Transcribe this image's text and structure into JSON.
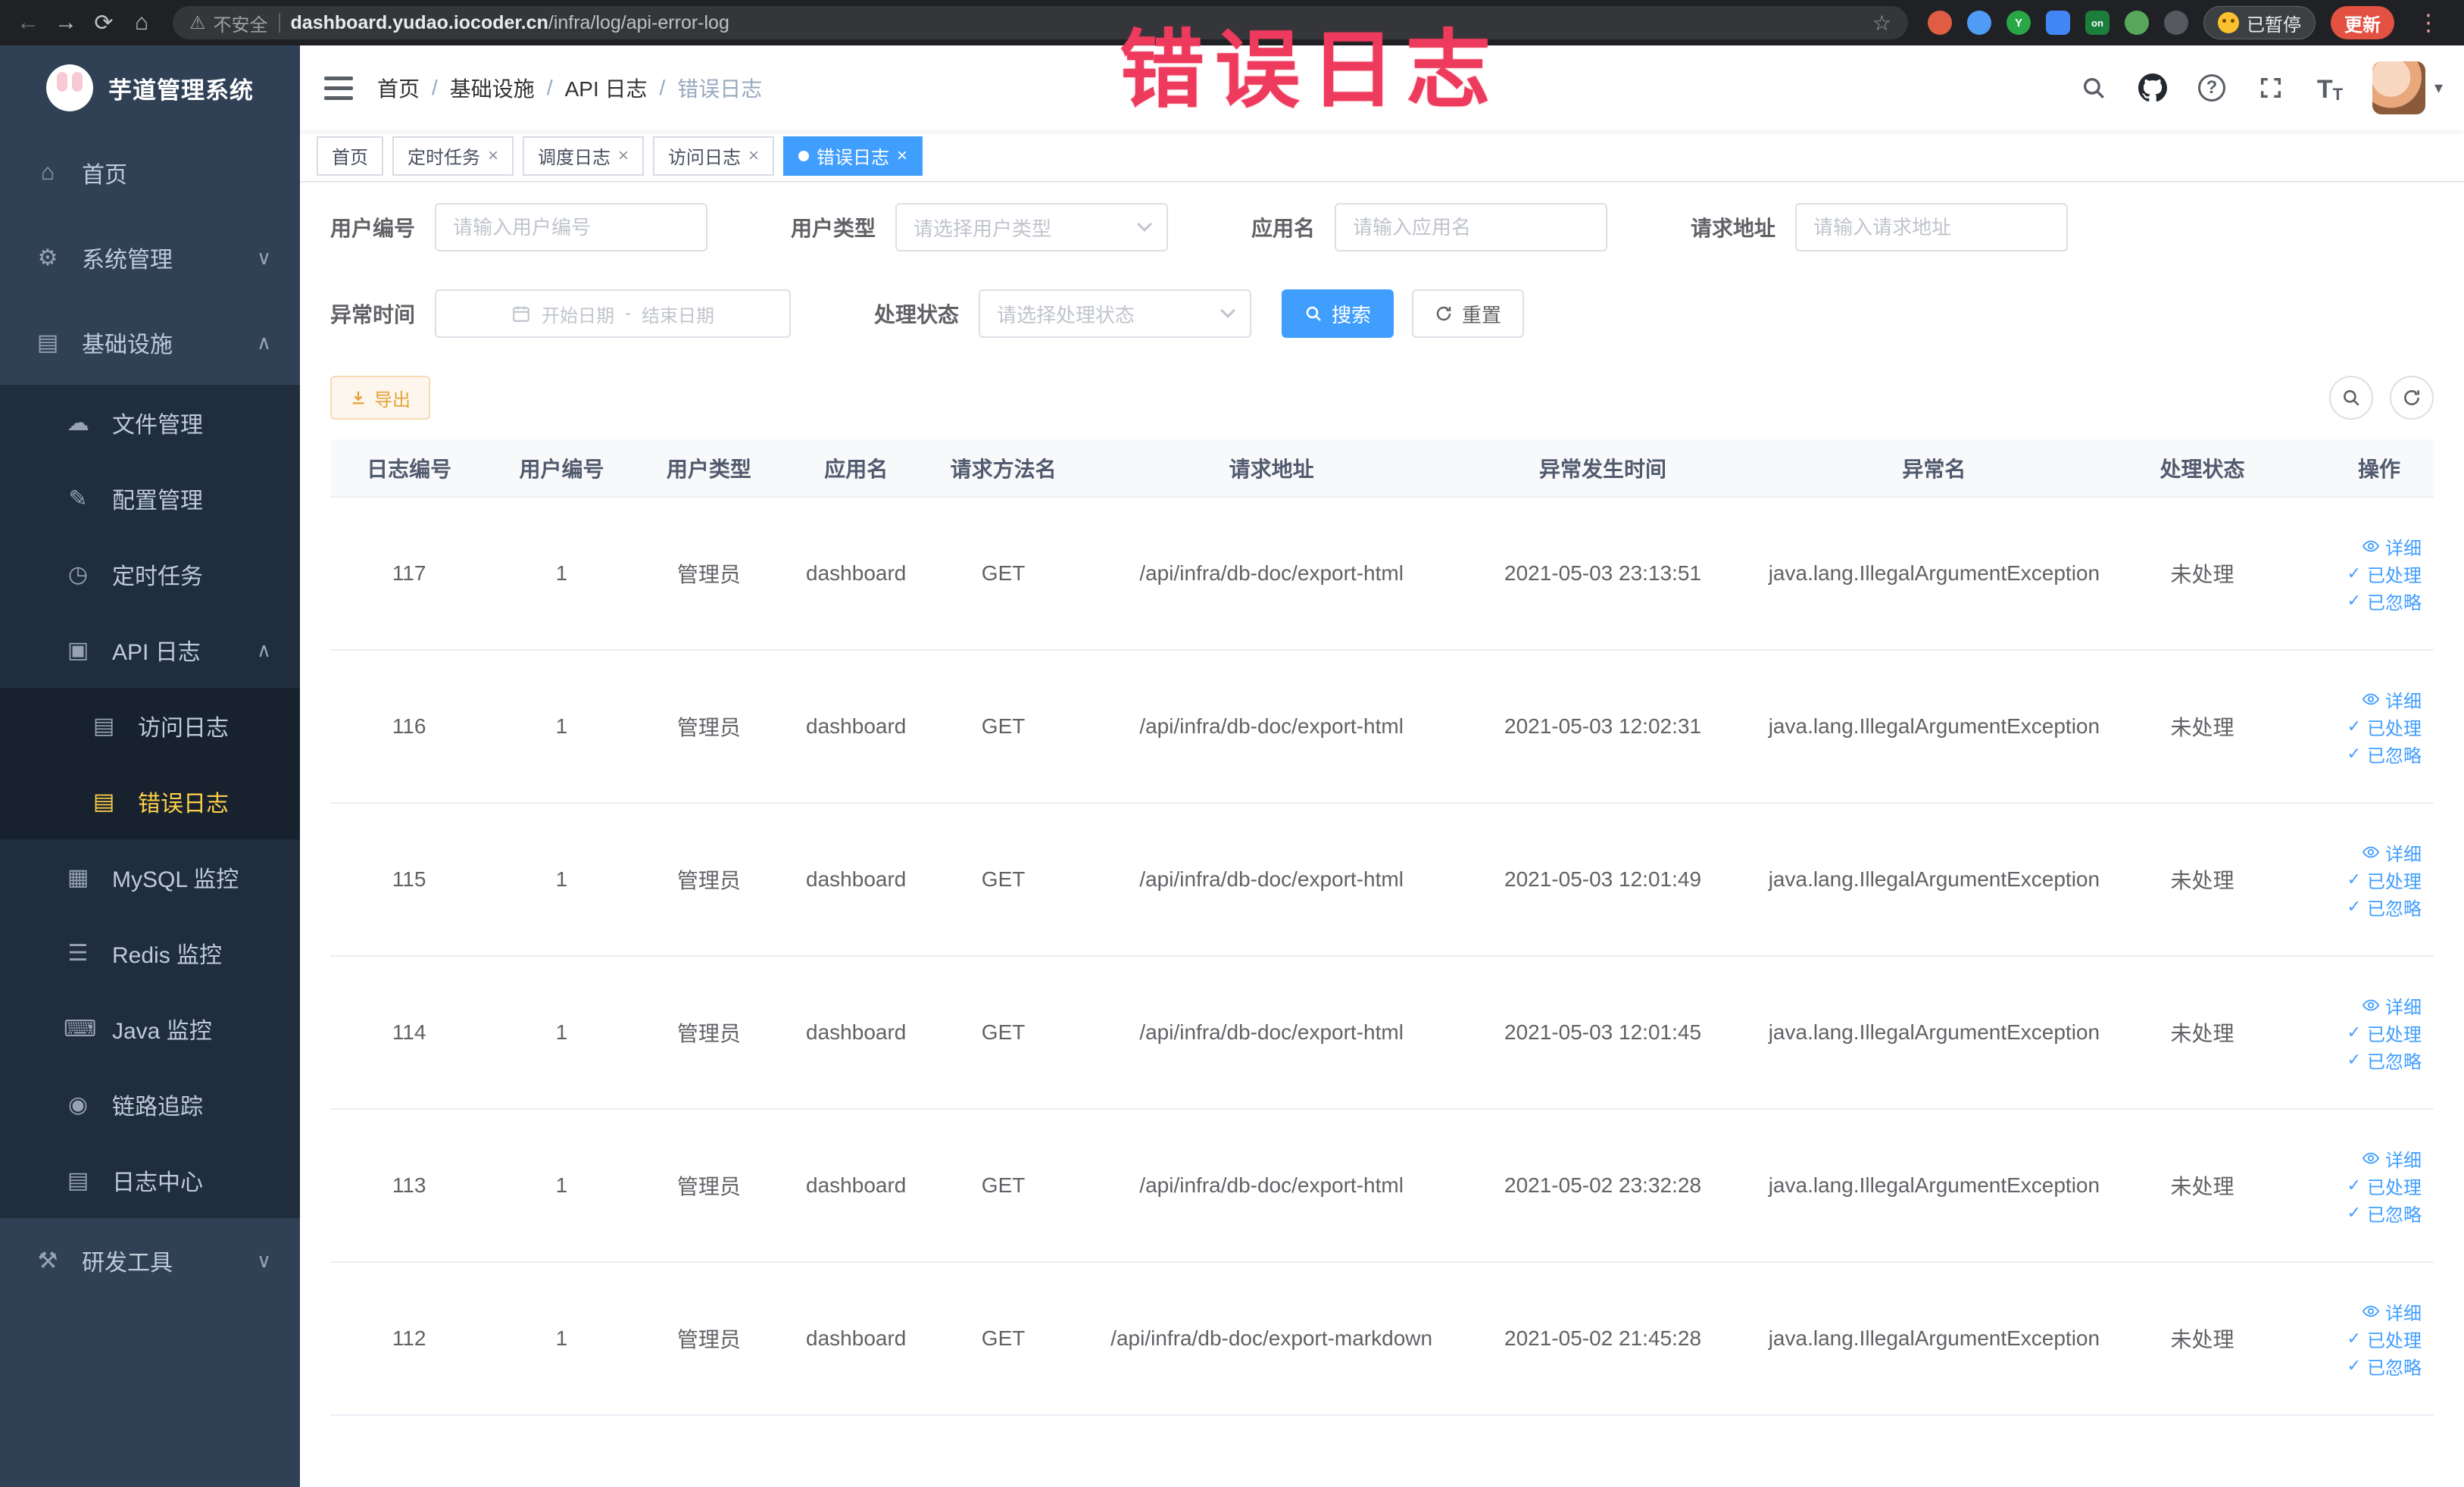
{
  "colors": {
    "primary": "#409eff",
    "warning": "#e6a23c",
    "sidebar_active": "#ffd04b",
    "annotation": "#ee3a5c"
  },
  "browser": {
    "security_label": "不安全",
    "url_domain": "dashboard.yudao.iocoder.cn",
    "url_path": "/infra/log/api-error-log",
    "extension_badge": "on",
    "paused_badge": "已暂停",
    "update_label": "更新"
  },
  "annotation": {
    "text": "错误日志"
  },
  "sidebar": {
    "title": "芋道管理系统",
    "items": [
      {
        "label": "首页"
      },
      {
        "label": "系统管理"
      },
      {
        "label": "基础设施"
      },
      {
        "label": "文件管理"
      },
      {
        "label": "配置管理"
      },
      {
        "label": "定时任务"
      },
      {
        "label": "API 日志"
      },
      {
        "label": "访问日志"
      },
      {
        "label": "错误日志"
      },
      {
        "label": "MySQL 监控"
      },
      {
        "label": "Redis 监控"
      },
      {
        "label": "Java 监控"
      },
      {
        "label": "链路追踪"
      },
      {
        "label": "日志中心"
      },
      {
        "label": "研发工具"
      }
    ]
  },
  "breadcrumb": {
    "items": [
      "首页",
      "基础设施",
      "API 日志",
      "错误日志"
    ],
    "separator": "/"
  },
  "tabs": [
    {
      "label": "首页"
    },
    {
      "label": "定时任务"
    },
    {
      "label": "调度日志"
    },
    {
      "label": "访问日志"
    },
    {
      "label": "错误日志"
    }
  ],
  "filters": {
    "user_id_label": "用户编号",
    "user_id_placeholder": "请输入用户编号",
    "user_type_label": "用户类型",
    "user_type_placeholder": "请选择用户类型",
    "app_name_label": "应用名",
    "app_name_placeholder": "请输入应用名",
    "request_url_label": "请求地址",
    "request_url_placeholder": "请输入请求地址",
    "time_label": "异常时间",
    "time_start_placeholder": "开始日期",
    "time_separator": "-",
    "time_end_placeholder": "结束日期",
    "status_label": "处理状态",
    "status_placeholder": "请选择处理状态",
    "search_label": "搜索",
    "reset_label": "重置"
  },
  "toolbar": {
    "export_label": "导出"
  },
  "table": {
    "columns": [
      "日志编号",
      "用户编号",
      "用户类型",
      "应用名",
      "请求方法名",
      "请求地址",
      "异常发生时间",
      "异常名",
      "处理状态",
      "操作"
    ],
    "actions": {
      "detail": "详细",
      "processed": "已处理",
      "ignored": "已忽略"
    },
    "rows": [
      {
        "log_id": "117",
        "user_id": "1",
        "user_type": "管理员",
        "app_name": "dashboard",
        "method": "GET",
        "url": "/api/infra/db-doc/export-html",
        "time": "2021-05-03 23:13:51",
        "exception": "java.lang.IllegalArgumentException",
        "status": "未处理"
      },
      {
        "log_id": "116",
        "user_id": "1",
        "user_type": "管理员",
        "app_name": "dashboard",
        "method": "GET",
        "url": "/api/infra/db-doc/export-html",
        "time": "2021-05-03 12:02:31",
        "exception": "java.lang.IllegalArgumentException",
        "status": "未处理"
      },
      {
        "log_id": "115",
        "user_id": "1",
        "user_type": "管理员",
        "app_name": "dashboard",
        "method": "GET",
        "url": "/api/infra/db-doc/export-html",
        "time": "2021-05-03 12:01:49",
        "exception": "java.lang.IllegalArgumentException",
        "status": "未处理"
      },
      {
        "log_id": "114",
        "user_id": "1",
        "user_type": "管理员",
        "app_name": "dashboard",
        "method": "GET",
        "url": "/api/infra/db-doc/export-html",
        "time": "2021-05-03 12:01:45",
        "exception": "java.lang.IllegalArgumentException",
        "status": "未处理"
      },
      {
        "log_id": "113",
        "user_id": "1",
        "user_type": "管理员",
        "app_name": "dashboard",
        "method": "GET",
        "url": "/api/infra/db-doc/export-html",
        "time": "2021-05-02 23:32:28",
        "exception": "java.lang.IllegalArgumentException",
        "status": "未处理"
      },
      {
        "log_id": "112",
        "user_id": "1",
        "user_type": "管理员",
        "app_name": "dashboard",
        "method": "GET",
        "url": "/api/infra/db-doc/export-markdown",
        "time": "2021-05-02 21:45:28",
        "exception": "java.lang.IllegalArgumentException",
        "status": "未处理"
      }
    ]
  },
  "icons": {
    "back": "←",
    "forward": "→",
    "reload": "⟳",
    "home": "⌂",
    "warning": "⚠",
    "star": "☆",
    "menu_dots": "⋮",
    "home_menu": "⌂",
    "system": "⚙",
    "infra": "▤",
    "file": "☁",
    "config": "✎",
    "job": "◷",
    "api_log": "▣",
    "access_log": "▤",
    "error_log": "▤",
    "mysql": "▦",
    "redis": "☰",
    "java": "⌨",
    "trace": "◉",
    "log_center": "▤",
    "devtools": "⚒",
    "chevron_down": "∨",
    "chevron_up": "∧",
    "close": "×",
    "check": "✓",
    "caret_down": "▾",
    "question": "?",
    "font_size": "T"
  }
}
